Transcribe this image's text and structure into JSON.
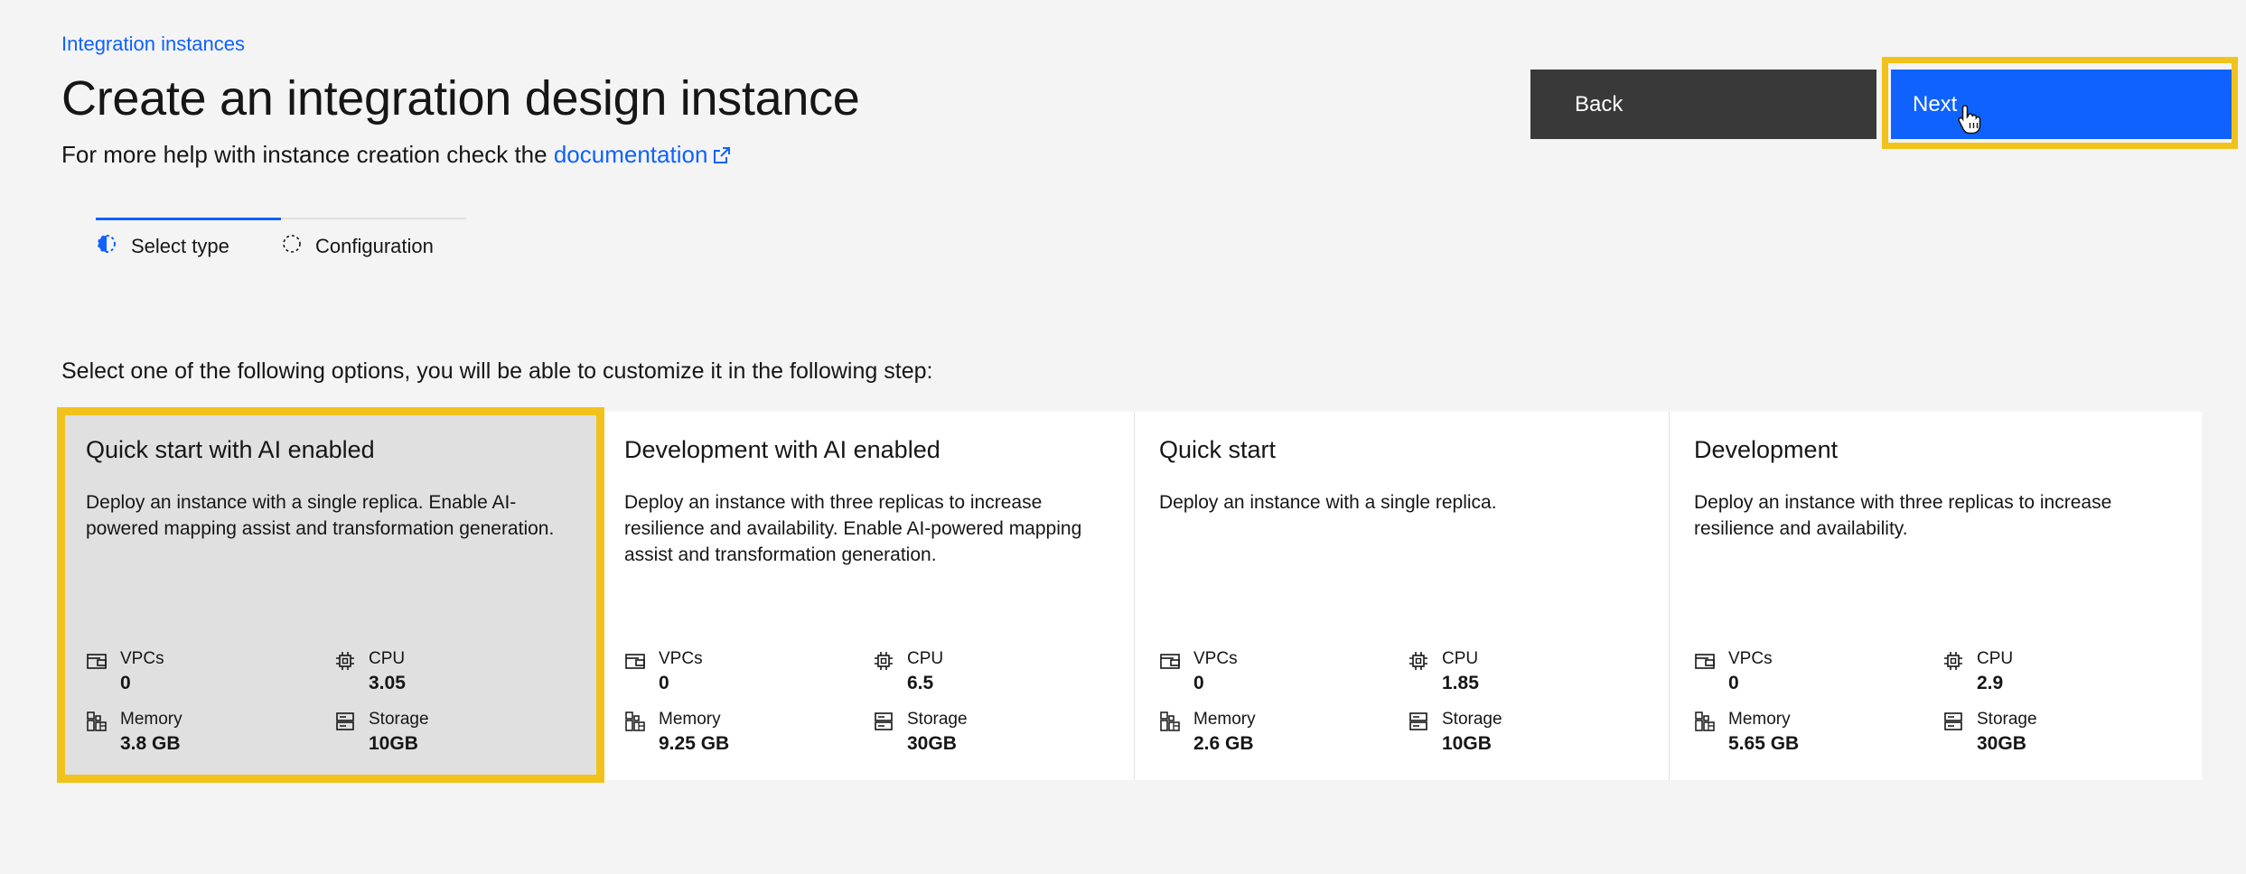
{
  "breadcrumb": "Integration instances",
  "title": "Create an integration design instance",
  "help": {
    "prefix": "For more help with instance creation check the",
    "link": "documentation"
  },
  "buttons": {
    "back": "Back",
    "next": "Next"
  },
  "progress": {
    "steps": [
      {
        "label": "Select type",
        "state": "current"
      },
      {
        "label": "Configuration",
        "state": "incomplete"
      }
    ]
  },
  "instructions": "Select one of the following options, you will be able to customize it in the following step:",
  "cards": [
    {
      "title": "Quick start with AI enabled",
      "description": "Deploy an instance with a single replica. Enable AI-powered mapping assist and transformation generation.",
      "selected": true,
      "metrics": {
        "vpcs_label": "VPCs",
        "vpcs": "0",
        "cpu_label": "CPU",
        "cpu": "3.05",
        "memory_label": "Memory",
        "memory": "3.8 GB",
        "storage_label": "Storage",
        "storage": "10GB"
      }
    },
    {
      "title": "Development with AI enabled",
      "description": "Deploy an instance with three replicas to increase resilience and availability. Enable AI-powered mapping assist and transformation generation.",
      "selected": false,
      "metrics": {
        "vpcs_label": "VPCs",
        "vpcs": "0",
        "cpu_label": "CPU",
        "cpu": "6.5",
        "memory_label": "Memory",
        "memory": "9.25 GB",
        "storage_label": "Storage",
        "storage": "30GB"
      }
    },
    {
      "title": "Quick start",
      "description": "Deploy an instance with a single replica.",
      "selected": false,
      "metrics": {
        "vpcs_label": "VPCs",
        "vpcs": "0",
        "cpu_label": "CPU",
        "cpu": "1.85",
        "memory_label": "Memory",
        "memory": "2.6 GB",
        "storage_label": "Storage",
        "storage": "10GB"
      }
    },
    {
      "title": "Development",
      "description": "Deploy an instance with three replicas to increase resilience and availability.",
      "selected": false,
      "metrics": {
        "vpcs_label": "VPCs",
        "vpcs": "0",
        "cpu_label": "CPU",
        "cpu": "2.9",
        "memory_label": "Memory",
        "memory": "5.65 GB",
        "storage_label": "Storage",
        "storage": "30GB"
      }
    }
  ],
  "icons": {
    "external_link": "launch-icon",
    "vpc": "vpc-icon",
    "cpu": "chip-icon",
    "memory": "memory-icon",
    "storage": "storage-icon",
    "step_current": "step-current-icon",
    "step_incomplete": "step-incomplete-icon",
    "cursor": "hand-pointer-icon"
  },
  "colors": {
    "accent": "#0f62fe",
    "highlight": "#f1c21b",
    "secondary_button": "#393939",
    "background": "#f4f4f4",
    "selected_card": "#e0e0e0"
  }
}
